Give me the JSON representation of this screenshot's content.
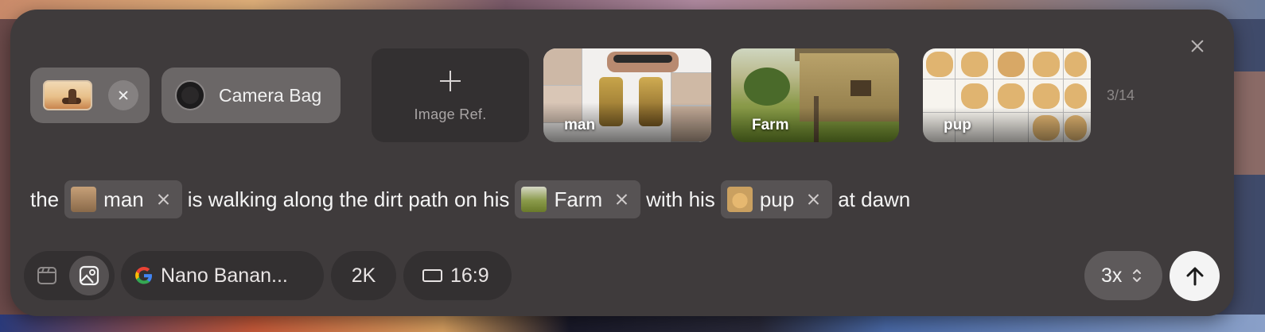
{
  "header": {
    "close_icon": "close-icon",
    "attachment_chip": {
      "thumbnail": "cowboy-on-horse-thumbnail",
      "remove_icon": "close-icon"
    },
    "camera_bag": {
      "label": "Camera Bag",
      "icon": "camera-lens-icon"
    },
    "image_ref": {
      "label": "Image Ref.",
      "icon": "plus-icon"
    },
    "references": [
      {
        "name": "man"
      },
      {
        "name": "Farm"
      },
      {
        "name": "pup"
      }
    ],
    "counter": "3/14"
  },
  "prompt": {
    "segments": [
      {
        "type": "text",
        "value": "the"
      },
      {
        "type": "ref",
        "value": "man"
      },
      {
        "type": "text",
        "value": "is walking along the dirt path on his"
      },
      {
        "type": "ref",
        "value": "Farm"
      },
      {
        "type": "text",
        "value": "with his"
      },
      {
        "type": "ref",
        "value": "pup"
      },
      {
        "type": "text",
        "value": "at dawn"
      }
    ],
    "t0": "the",
    "r1": "man",
    "t1": "is walking along the dirt path on his",
    "r2": "Farm",
    "t2": "with his",
    "r3": "pup",
    "t3": "at dawn"
  },
  "toolbar": {
    "mode_video_icon": "video-clip-icon",
    "mode_image_icon": "image-icon",
    "model": {
      "label": "Nano Banan...",
      "icon": "google-icon"
    },
    "resolution": "2K",
    "aspect_ratio": {
      "label": "16:9",
      "icon": "aspect-ratio-icon"
    },
    "count": {
      "label": "3x",
      "icon": "chevron-updown-icon"
    },
    "send_icon": "arrow-up-icon"
  },
  "colors": {
    "panel_bg": "#3f3b3c",
    "chip_bg": "#6b6767",
    "pill_bg": "#333031",
    "send_bg": "#f4f4f4"
  }
}
